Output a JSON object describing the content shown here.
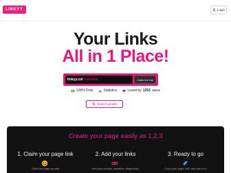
{
  "header": {
    "logo_text": "LINKYY",
    "login_label": "Login"
  },
  "hero": {
    "title_line1": "Your Links",
    "title_line2": "All in 1 Place!",
    "claim": {
      "prefix": "linkyy.co/",
      "placeholder": "yourname",
      "button_label": "Claim the link"
    },
    "stats": [
      {
        "icon": "money-icon",
        "text": "100% Free"
      },
      {
        "icon": "chart-icon",
        "text": "Statistics"
      },
      {
        "icon": "heart-icon",
        "prefix": "Loved by",
        "count": "1253",
        "suffix": "users"
      }
    ],
    "search_people_label": "Search people"
  },
  "steps_section": {
    "title": "Create your page easily as 1,2,3",
    "steps": [
      {
        "title": "1. Claim your page link",
        "icon": "smile-icon",
        "desc": "Claim the page up with"
      },
      {
        "title": "2. Add your links",
        "icon": "link-icon",
        "desc": "Add your socials, websites, blogs links,"
      },
      {
        "title": "3. Ready to go",
        "icon": "rocket-icon",
        "desc": "Copy your page URL and use it on"
      }
    ]
  },
  "colors": {
    "accent": "#e8177a",
    "dark": "#121212",
    "text": "#1a1a1a"
  }
}
